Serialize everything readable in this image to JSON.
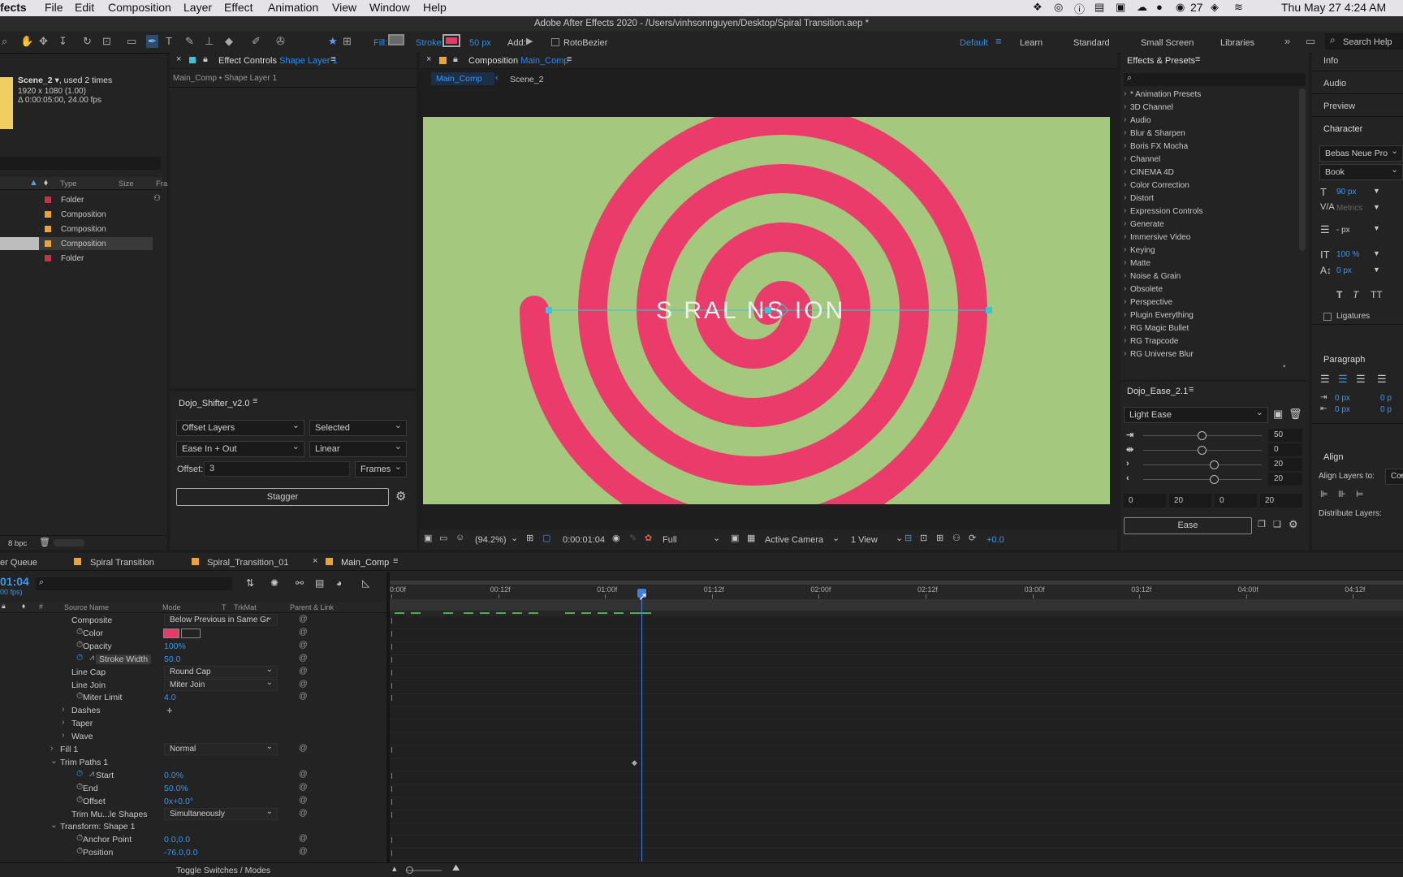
{
  "menubar": {
    "app": "fects",
    "items": [
      "File",
      "Edit",
      "Composition",
      "Layer",
      "Effect",
      "Animation",
      "View",
      "Window",
      "Help"
    ],
    "status_num": "27",
    "clock": "Thu May 27  4:24 AM"
  },
  "titlebar": {
    "title": "Adobe After Effects 2020 - /Users/vinhsonnguyen/Desktop/Spiral Transition.aep *"
  },
  "toolbar": {
    "fill_label": "Fill:",
    "stroke_label": "Stroke:",
    "stroke_width": "50 px",
    "add_label": "Add:",
    "rotobezier": "RotoBezier",
    "workspaces": [
      "Default",
      "Learn",
      "Standard",
      "Small Screen",
      "Libraries"
    ],
    "search_help": "Search Help",
    "colors": {
      "stroke": "#e83a6a",
      "fill": "#6a6a6a"
    }
  },
  "project": {
    "item_name": "Scene_2",
    "item_used": ", used 2 times",
    "item_size": "1920 x 1080 (1.00)",
    "item_duration": "Δ 0:00:05:00, 24.00 fps",
    "col_type": "Type",
    "col_size": "Size",
    "col_fr": "Fra",
    "rows": [
      {
        "type": "Folder",
        "color": "#c4314b"
      },
      {
        "type": "Composition",
        "color": "#e8a33c"
      },
      {
        "type": "Composition",
        "color": "#e8a33c"
      },
      {
        "type": "Composition",
        "color": "#e8a33c"
      },
      {
        "type": "Folder",
        "color": "#c4314b"
      }
    ],
    "bpc": "8 bpc"
  },
  "effect_controls": {
    "tab_label": "Effect Controls",
    "tab_layer": "Shape Layer 1",
    "breadcrumb": "Main_Comp • Shape Layer 1"
  },
  "dojo_shifter": {
    "title": "Dojo_Shifter_v2.0",
    "select1": "Offset Layers",
    "select2": "Selected",
    "select3": "Ease In + Out",
    "select4": "Linear",
    "offset_label": "Offset:",
    "offset_value": "3",
    "unit": "Frames",
    "button": "Stagger"
  },
  "composition": {
    "tab_label": "Composition",
    "tab_comp": "Main_Comp",
    "crumb1": "Main_Comp",
    "crumb2": "Scene_2",
    "overlay_text": "S  RAL    NS  ION",
    "bg_color": "#a4c97e",
    "spiral_color": "#ea3b6b",
    "zoom": "(94.2%)",
    "time": "0:00:01:04",
    "resolution": "Full",
    "camera": "Active Camera",
    "view": "1 View",
    "exposure": "+0.0"
  },
  "effects_presets": {
    "title": "Effects & Presets",
    "items": [
      "* Animation Presets",
      "3D Channel",
      "Audio",
      "Blur & Sharpen",
      "Boris FX Mocha",
      "Channel",
      "CINEMA 4D",
      "Color Correction",
      "Distort",
      "Expression Controls",
      "Generate",
      "Immersive Video",
      "Keying",
      "Matte",
      "Noise & Grain",
      "Obsolete",
      "Perspective",
      "Plugin Everything",
      "RG Magic Bullet",
      "RG Trapcode",
      "RG Universe Blur"
    ]
  },
  "dojo_ease": {
    "title": "Dojo_Ease_2.1",
    "preset": "Light Ease",
    "sliders": [
      {
        "value": "50",
        "level": 0.5
      },
      {
        "value": "0",
        "level": 0.5
      },
      {
        "value": "20",
        "level": 0.6
      },
      {
        "value": "20",
        "level": 0.6
      }
    ],
    "fields": [
      "0",
      "20",
      "0",
      "20"
    ],
    "button": "Ease"
  },
  "right_panel": {
    "tabs": [
      "Info",
      "Audio",
      "Preview",
      "Character"
    ],
    "font": "Bebas Neue Pro",
    "style": "Book",
    "size": "90 px",
    "kerning": "Metrics",
    "leading": "- px",
    "vscale": "100 %",
    "baseline": "0 px",
    "ligatures": "Ligatures",
    "paragraph": "Paragraph",
    "indent1": "0 px",
    "indent2": "0 px",
    "indent3": "0 p",
    "indent4": "0 p",
    "align": "Align",
    "align_to": "Align Layers to:",
    "align_to_value": "Cor",
    "distribute": "Distribute Layers:"
  },
  "timeline": {
    "tabs": [
      "er Queue",
      "Spiral Transition",
      "Spiral_Transition_01",
      "Main_Comp"
    ],
    "timecode": "01:04",
    "fps": "00 fps)",
    "col_source": "Source Name",
    "col_mode": "Mode",
    "col_t": "T",
    "col_trkmat": "TrkMat",
    "col_parent": "Parent & Link",
    "ruler": [
      "0:00f",
      "00:12f",
      "01:00f",
      "01:12f",
      "02:00f",
      "02:12f",
      "03:00f",
      "03:12f",
      "04:00f",
      "04:12f"
    ],
    "rows": [
      {
        "name": "Composite",
        "value": "Below Previous in Same Gr",
        "kind": "drop",
        "indent": 88
      },
      {
        "name": "Color",
        "value": "",
        "kind": "color",
        "indent": 102
      },
      {
        "name": "Opacity",
        "value": "100%",
        "kind": "val",
        "indent": 102
      },
      {
        "name": "Stroke Width",
        "value": "50.0",
        "kind": "val",
        "indent": 118
      },
      {
        "name": "Line Cap",
        "value": "Round Cap",
        "kind": "drop",
        "indent": 88
      },
      {
        "name": "Line Join",
        "value": "Miter Join",
        "kind": "drop",
        "indent": 88
      },
      {
        "name": "Miter Limit",
        "value": "4.0",
        "kind": "val",
        "indent": 102
      },
      {
        "name": "Dashes",
        "value": "+",
        "kind": "plus",
        "indent": 88
      },
      {
        "name": "Taper",
        "value": "",
        "kind": "none",
        "indent": 88
      },
      {
        "name": "Wave",
        "value": "",
        "kind": "none",
        "indent": 88
      },
      {
        "name": "Fill 1",
        "value": "Normal",
        "kind": "drop",
        "indent": 74
      },
      {
        "name": "Trim Paths 1",
        "value": "",
        "kind": "none",
        "indent": 74
      },
      {
        "name": "Start",
        "value": "0.0%",
        "kind": "val",
        "indent": 118
      },
      {
        "name": "End",
        "value": "50.0%",
        "kind": "val",
        "indent": 102
      },
      {
        "name": "Offset",
        "value": "0x+0.0°",
        "kind": "val",
        "indent": 102
      },
      {
        "name": "Trim Mu...le Shapes",
        "value": "Simultaneously",
        "kind": "drop",
        "indent": 88
      },
      {
        "name": "Transform: Shape 1",
        "value": "",
        "kind": "none",
        "indent": 74
      },
      {
        "name": "Anchor Point",
        "value": "0.0,0.0",
        "kind": "val",
        "indent": 102
      },
      {
        "name": "Position",
        "value": "-76.0,0.0",
        "kind": "val",
        "indent": 102
      }
    ],
    "toggle": "Toggle Switches / Modes"
  }
}
